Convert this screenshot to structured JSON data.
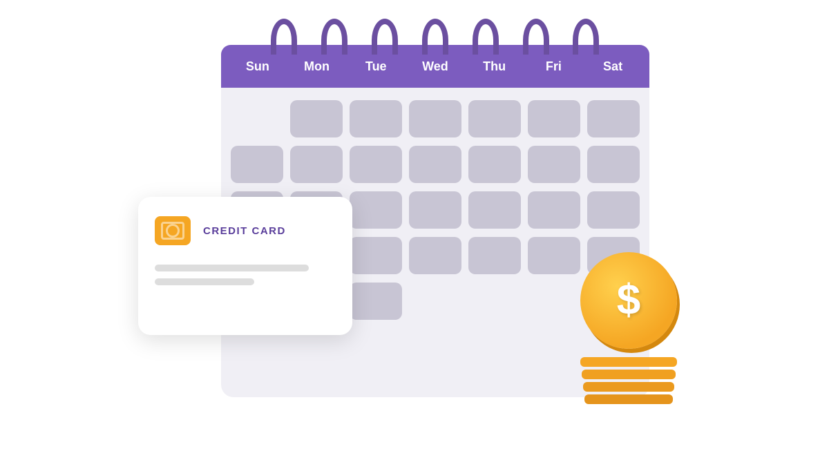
{
  "calendar": {
    "days": [
      "Sun",
      "Mon",
      "Tue",
      "Wed",
      "Thu",
      "Fri",
      "Sat"
    ],
    "rows": 5,
    "cols": 7
  },
  "creditCard": {
    "title": "CREDIT CARD",
    "chipColor": "#f5a623"
  },
  "coin": {
    "symbol": "$"
  },
  "colors": {
    "calendarHeaderBg": "#7c5cbf",
    "calendarBodyBg": "#f0eff5",
    "cellBg": "#c8c5d4",
    "ringColor": "#6b4fa0",
    "coinColor": "#f5a623",
    "cardBg": "#ffffff",
    "cardTitleColor": "#5a3e9b"
  }
}
